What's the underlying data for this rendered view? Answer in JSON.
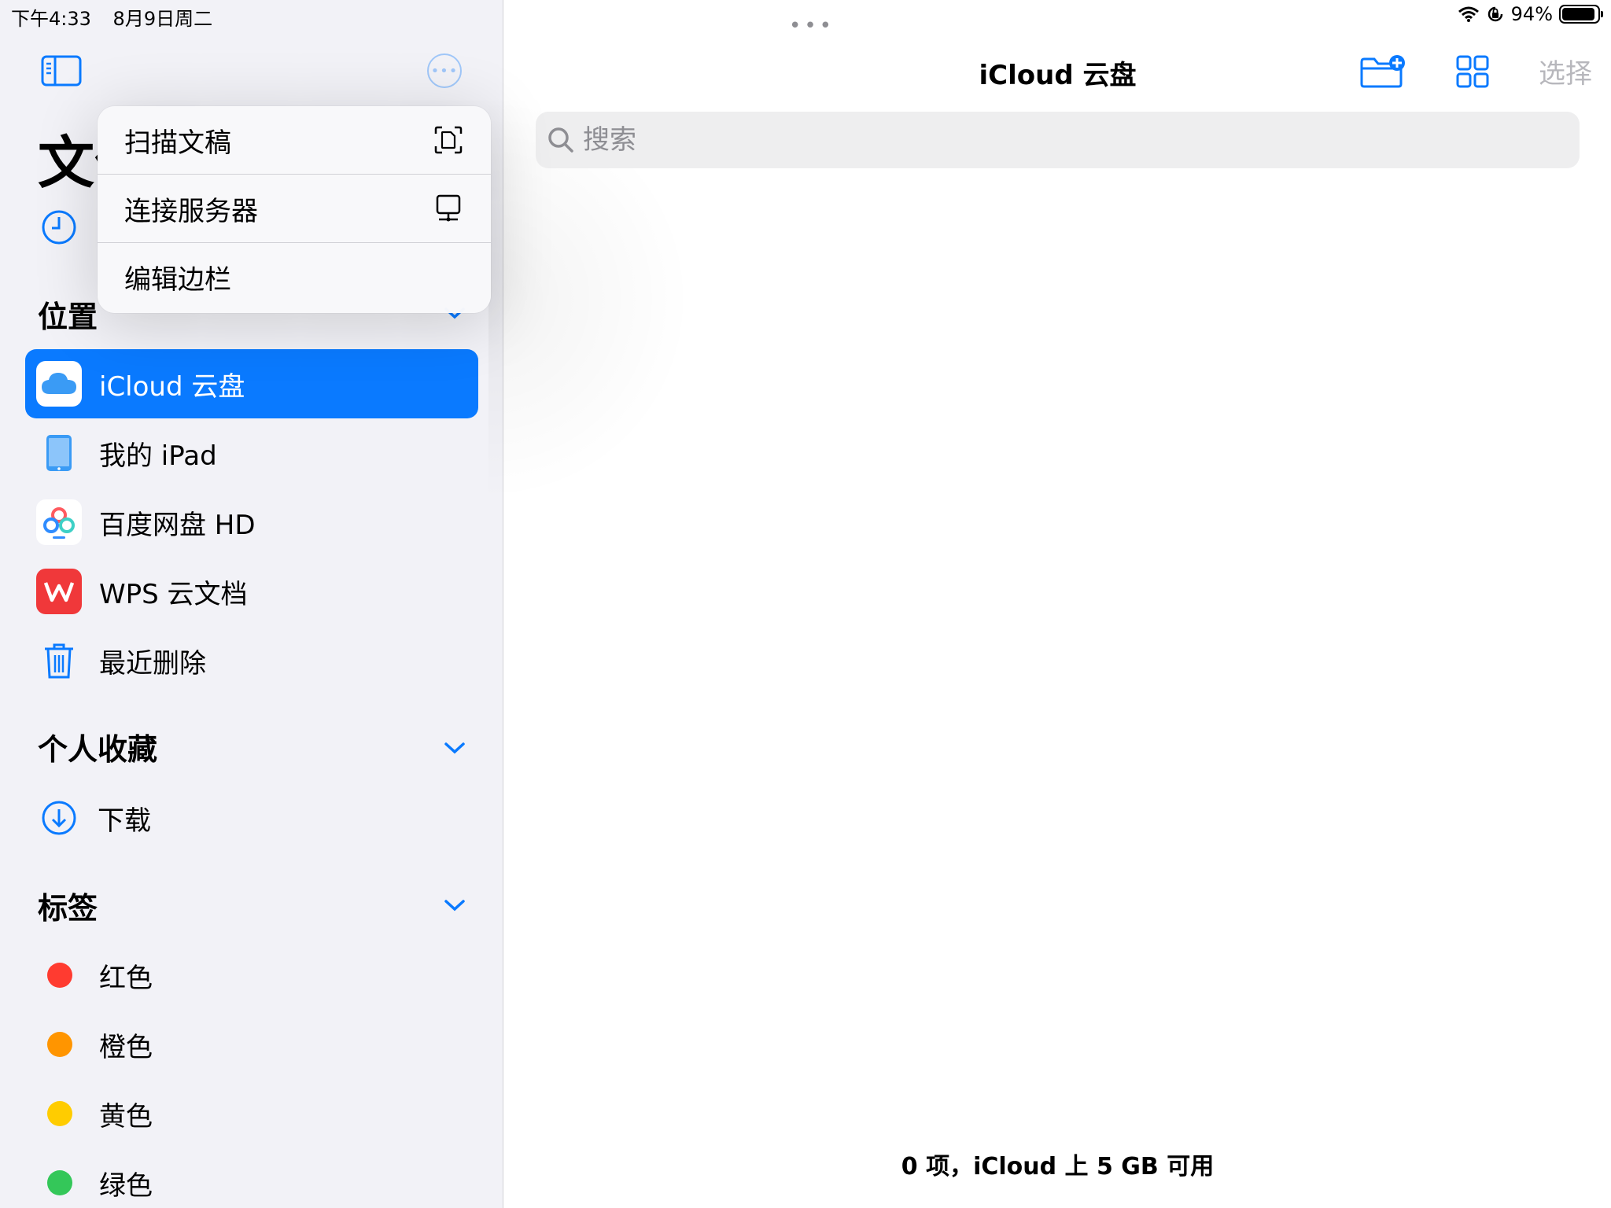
{
  "status": {
    "time": "下午4:33",
    "date": "8月9日周二",
    "battery": "94%",
    "battery_level": 0.94
  },
  "sidebar": {
    "title_partial": "文件",
    "sections": {
      "locations": "位置",
      "favorites": "个人收藏",
      "tags": "标签"
    },
    "locations": [
      {
        "label": "iCloud 云盘",
        "icon": "icloud-icon",
        "selected": true
      },
      {
        "label": "我的 iPad",
        "icon": "ipad-icon"
      },
      {
        "label": "百度网盘 HD",
        "icon": "baidu-netdisk-icon"
      },
      {
        "label": "WPS 云文档",
        "icon": "wps-icon"
      },
      {
        "label": "最近删除",
        "icon": "trash-icon"
      }
    ],
    "favorites": [
      {
        "label": "下载",
        "icon": "download-icon"
      }
    ],
    "tags": [
      {
        "label": "红色",
        "color": "#ff3b30"
      },
      {
        "label": "橙色",
        "color": "#ff9500"
      },
      {
        "label": "黄色",
        "color": "#ffcc00"
      },
      {
        "label": "绿色",
        "color": "#34c759"
      }
    ]
  },
  "menu": {
    "items": [
      {
        "label": "扫描文稿",
        "icon": "scan-document-icon"
      },
      {
        "label": "连接服务器",
        "icon": "connect-server-icon"
      },
      {
        "label": "编辑边栏",
        "icon": ""
      }
    ]
  },
  "main": {
    "title": "iCloud 云盘",
    "select_label": "选择",
    "search_placeholder": "搜索",
    "footer": "0 项，iCloud 上 5 GB 可用"
  },
  "colors": {
    "accent": "#0a7aff",
    "sidebar_bg": "#f2f2f7"
  }
}
